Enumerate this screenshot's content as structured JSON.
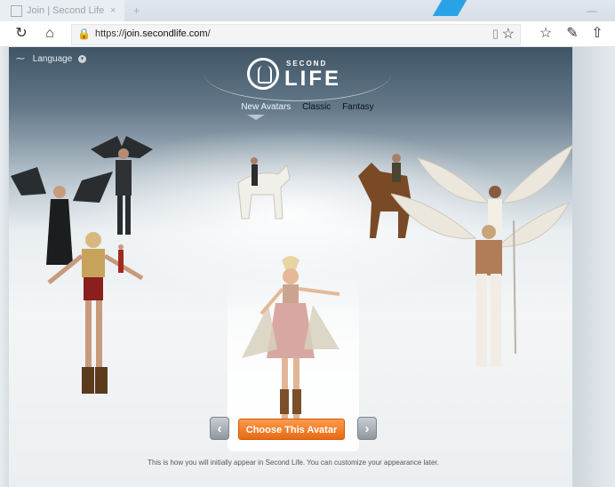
{
  "browser": {
    "tab_title": "Join | Second Life",
    "tab_close": "×",
    "new_tab": "+",
    "minimize": "—",
    "url_protocol": "https://",
    "url_domain": "join.secondlife.com",
    "url_path": "/"
  },
  "page": {
    "language_label": "Language",
    "logo_second": "SECOND",
    "logo_life": "LIFE",
    "categories": [
      "New Avatars",
      "Classic",
      "Fantasy"
    ],
    "active_category": "New Avatars",
    "choose_button": "Choose This Avatar",
    "prev_arrow": "‹",
    "next_arrow": "›",
    "note": "This is how you will initially appear in Second Life. You can customize your appearance later."
  },
  "colors": {
    "accent_orange": "#f07a20",
    "header_dark": "#3f5566",
    "edge_blue": "#29a3e6"
  }
}
